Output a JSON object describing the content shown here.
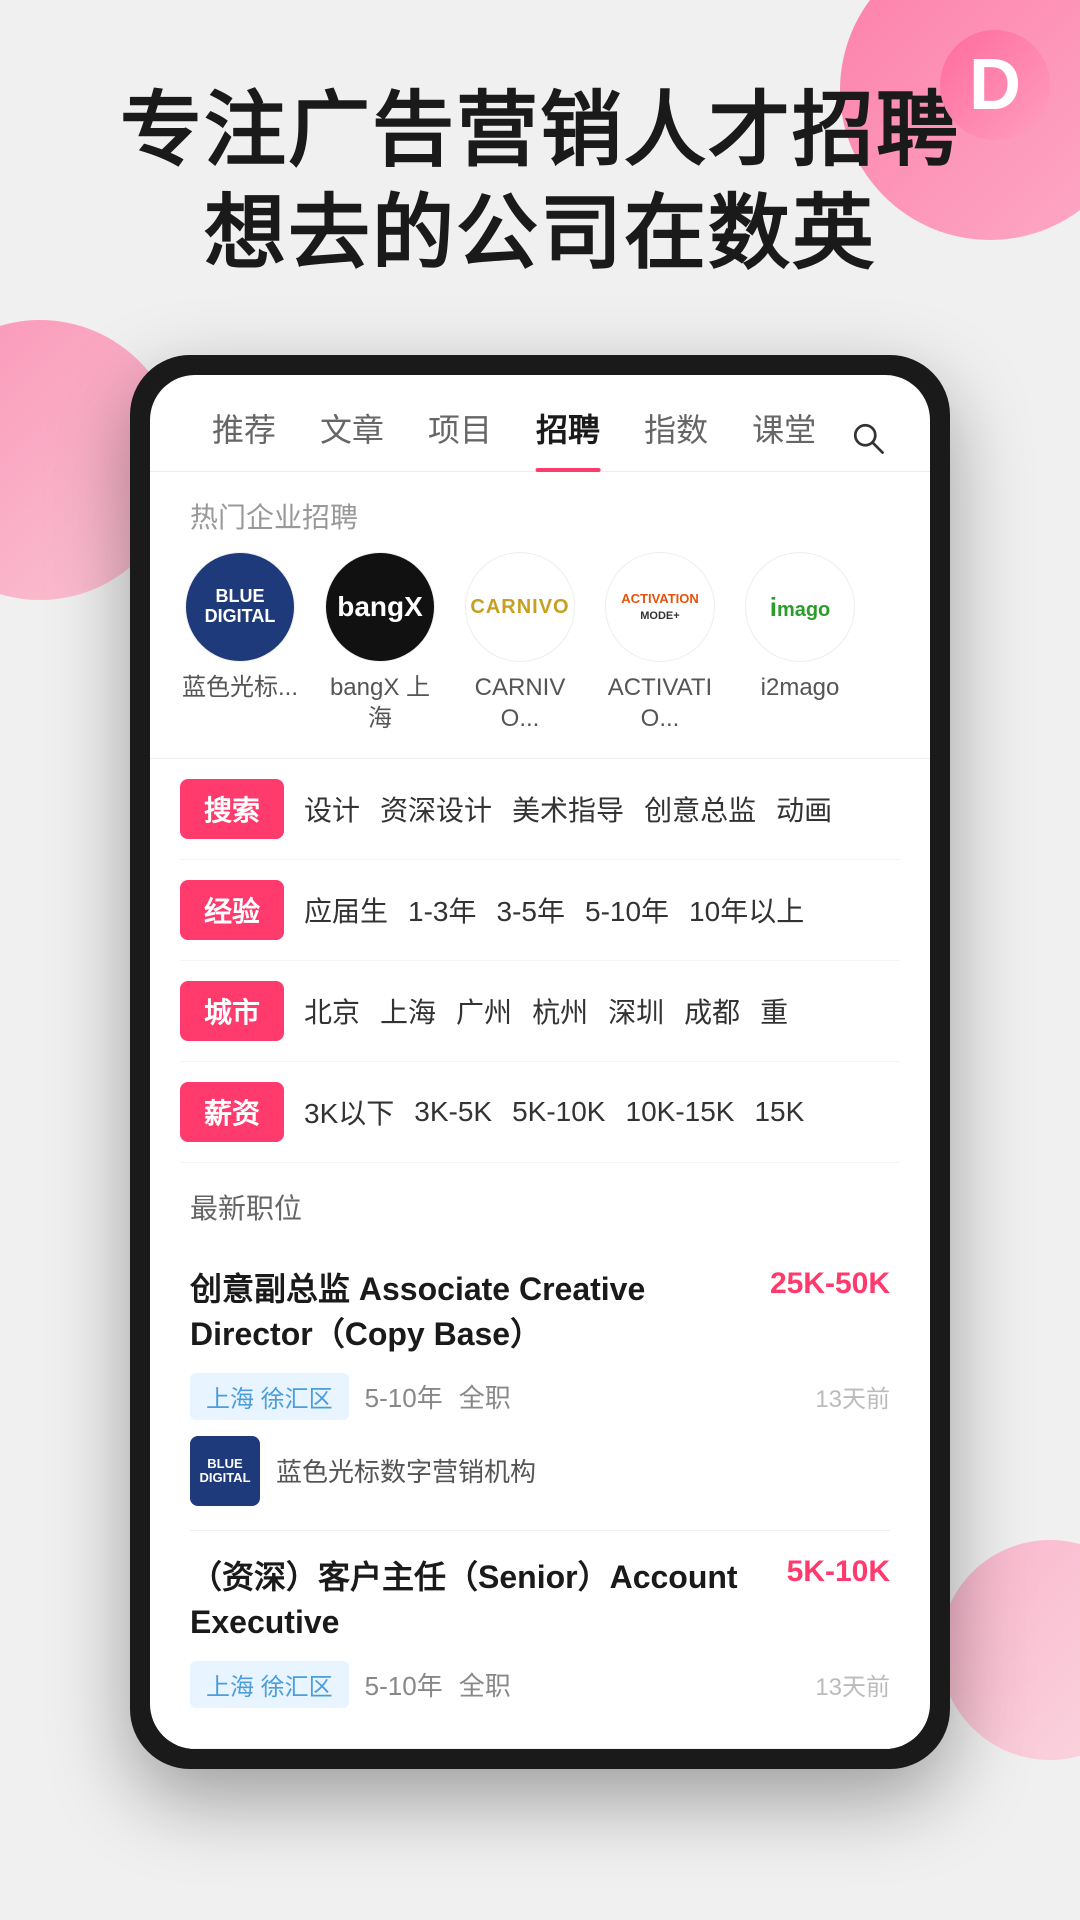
{
  "app": {
    "icon_letter": "D",
    "hero_line1": "专注广告营销人才招聘",
    "hero_line2": "想去的公司在数英"
  },
  "nav": {
    "tabs": [
      {
        "label": "推荐",
        "active": false
      },
      {
        "label": "文章",
        "active": false
      },
      {
        "label": "项目",
        "active": false
      },
      {
        "label": "招聘",
        "active": true
      },
      {
        "label": "指数",
        "active": false
      },
      {
        "label": "课堂",
        "active": false
      }
    ],
    "search_label": "搜索"
  },
  "hot_companies": {
    "section_label": "热门企业招聘",
    "companies": [
      {
        "name": "蓝色光标...",
        "logo_text": "BLUE\nDIGITAL",
        "logo_style": "blue-digital"
      },
      {
        "name": "bangX 上海",
        "logo_text": "bangX",
        "logo_style": "bangx"
      },
      {
        "name": "CARNIVO...",
        "logo_text": "CARNIVO",
        "logo_style": "carnivo"
      },
      {
        "name": "ACTIVATIO...",
        "logo_text": "ACTIVATION\nMODE+",
        "logo_style": "activation"
      },
      {
        "name": "i2mago",
        "logo_text": "i\nmago",
        "logo_style": "i2mago"
      }
    ]
  },
  "filters": [
    {
      "tag": "搜索",
      "options": [
        "设计",
        "资深设计",
        "美术指导",
        "创意总监",
        "动画"
      ]
    },
    {
      "tag": "经验",
      "options": [
        "应届生",
        "1-3年",
        "3-5年",
        "5-10年",
        "10年以上"
      ]
    },
    {
      "tag": "城市",
      "options": [
        "北京",
        "上海",
        "广州",
        "杭州",
        "深圳",
        "成都",
        "重"
      ]
    },
    {
      "tag": "薪资",
      "options": [
        "3K以下",
        "3K-5K",
        "5K-10K",
        "10K-15K",
        "15K"
      ]
    }
  ],
  "jobs": {
    "section_label": "最新职位",
    "listings": [
      {
        "title": "创意副总监 Associate Creative Director（Copy Base）",
        "salary": "25K-50K",
        "location": "上海 徐汇区",
        "experience": "5-10年",
        "job_type": "全职",
        "time_ago": "13天前",
        "company_logo": "BLUE\nDIGITAL",
        "company_name": "蓝色光标数字营销机构"
      },
      {
        "title": "（资深）客户主任（Senior）Account Executive",
        "salary": "5K-10K",
        "location": "上海 徐汇区",
        "experience": "5-10年",
        "job_type": "全职",
        "time_ago": "13天前",
        "company_logo": "",
        "company_name": ""
      }
    ]
  }
}
